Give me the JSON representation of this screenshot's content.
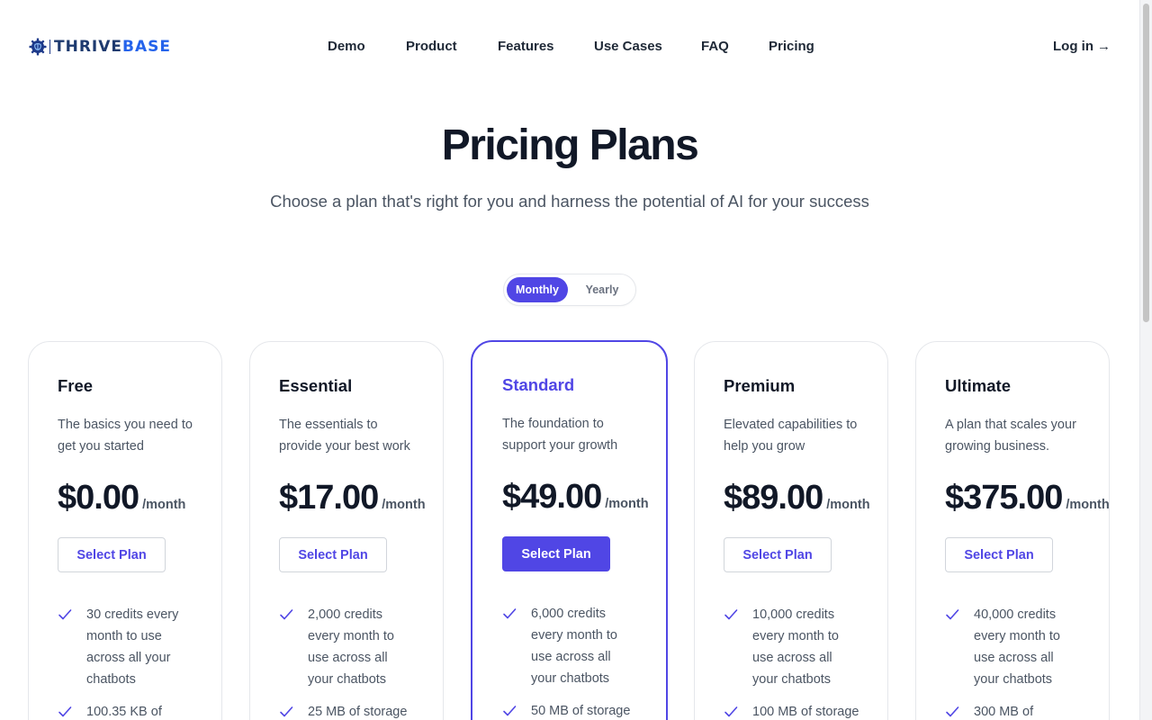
{
  "brand": {
    "name_part1": "THRIVE",
    "name_part2": "BASE",
    "icon": "gear-brain-icon"
  },
  "nav": {
    "items": [
      {
        "label": "Demo"
      },
      {
        "label": "Product"
      },
      {
        "label": "Features"
      },
      {
        "label": "Use Cases"
      },
      {
        "label": "FAQ"
      },
      {
        "label": "Pricing"
      }
    ],
    "login_label": "Log in",
    "login_arrow": "→"
  },
  "hero": {
    "title": "Pricing Plans",
    "subtitle": "Choose a plan that's right for you and harness the potential of AI for your success"
  },
  "billing_toggle": {
    "options": [
      "Monthly",
      "Yearly"
    ],
    "selected": "Monthly"
  },
  "colors": {
    "accent": "#5046e5",
    "text_dark": "#111827",
    "text_muted": "#4b5563"
  },
  "plans": [
    {
      "name": "Free",
      "description": "The basics you need to get you started",
      "price": "$0.00",
      "period": "/month",
      "button": "Select Plan",
      "featured": false,
      "features": [
        "30 credits every month to use across all your chatbots",
        "100.35 KB of"
      ]
    },
    {
      "name": "Essential",
      "description": "The essentials to provide your best work",
      "price": "$17.00",
      "period": "/month",
      "button": "Select Plan",
      "featured": false,
      "features": [
        "2,000 credits every month to use across all your chatbots",
        "25 MB of storage"
      ]
    },
    {
      "name": "Standard",
      "description": "The foundation to support your growth",
      "price": "$49.00",
      "period": "/month",
      "button": "Select Plan",
      "featured": true,
      "features": [
        "6,000 credits every month to use across all your chatbots",
        "50 MB of storage"
      ]
    },
    {
      "name": "Premium",
      "description": "Elevated capabilities to help you grow",
      "price": "$89.00",
      "period": "/month",
      "button": "Select Plan",
      "featured": false,
      "features": [
        "10,000 credits every month to use across all your chatbots",
        "100 MB of storage"
      ]
    },
    {
      "name": "Ultimate",
      "description": "A plan that scales your growing business.",
      "price": "$375.00",
      "period": "/month",
      "button": "Select Plan",
      "featured": false,
      "features": [
        "40,000 credits every month to use across all your chatbots",
        "300 MB of"
      ]
    }
  ]
}
